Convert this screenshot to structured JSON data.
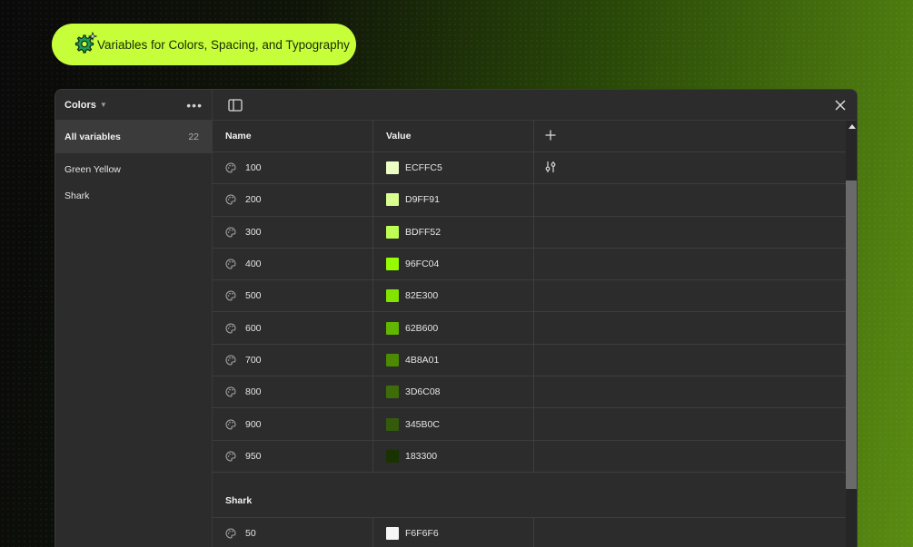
{
  "banner": {
    "text": "Variables for Colors, Spacing, and Typography",
    "icon": "sparkle-gear-icon",
    "color": "#c6ff3a"
  },
  "sidebar": {
    "title": "Colors",
    "all_label": "All variables",
    "all_count": "22",
    "groups": [
      {
        "label": "Green Yellow"
      },
      {
        "label": "Shark"
      }
    ]
  },
  "table": {
    "headers": {
      "name": "Name",
      "value": "Value"
    },
    "rows": [
      {
        "name": "100",
        "value": "ECFFC5",
        "color": "#ECFFC5"
      },
      {
        "name": "200",
        "value": "D9FF91",
        "color": "#D9FF91"
      },
      {
        "name": "300",
        "value": "BDFF52",
        "color": "#BDFF52"
      },
      {
        "name": "400",
        "value": "96FC04",
        "color": "#96FC04"
      },
      {
        "name": "500",
        "value": "82E300",
        "color": "#82E300"
      },
      {
        "name": "600",
        "value": "62B600",
        "color": "#62B600"
      },
      {
        "name": "700",
        "value": "4B8A01",
        "color": "#4B8A01"
      },
      {
        "name": "800",
        "value": "3D6C08",
        "color": "#3D6C08"
      },
      {
        "name": "900",
        "value": "345B0C",
        "color": "#345B0C"
      },
      {
        "name": "950",
        "value": "183300",
        "color": "#183300"
      }
    ],
    "group2": {
      "title": "Shark",
      "rows": [
        {
          "name": "50",
          "value": "F6F6F6",
          "color": "#F6F6F6"
        }
      ]
    }
  }
}
